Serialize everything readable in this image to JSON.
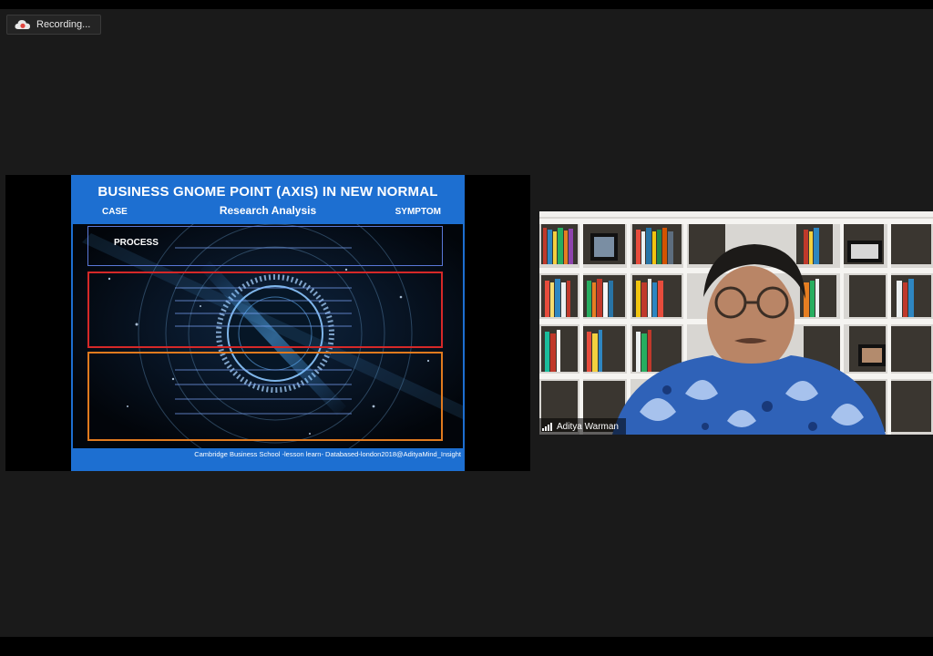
{
  "recording": {
    "label": "Recording...",
    "icon": "cloud-record-icon"
  },
  "slide": {
    "title": "BUSINESS GNOME POINT (AXIS) IN NEW NORMAL",
    "left_label": "CASE",
    "center_label": "Research Analysis",
    "right_label": "SYMPTOM",
    "process_label": "PROCESS",
    "footer": "Cambridge Business School -lesson learn- Databased-london2018@AdityaMind_Insight"
  },
  "participant": {
    "name": "Aditya Warman",
    "icon": "signal-bars-icon"
  },
  "colors": {
    "background": "#1a1a1a",
    "slide_blue": "#1d6fd1",
    "box_red": "#d62828",
    "box_orange": "#e07a1e"
  }
}
